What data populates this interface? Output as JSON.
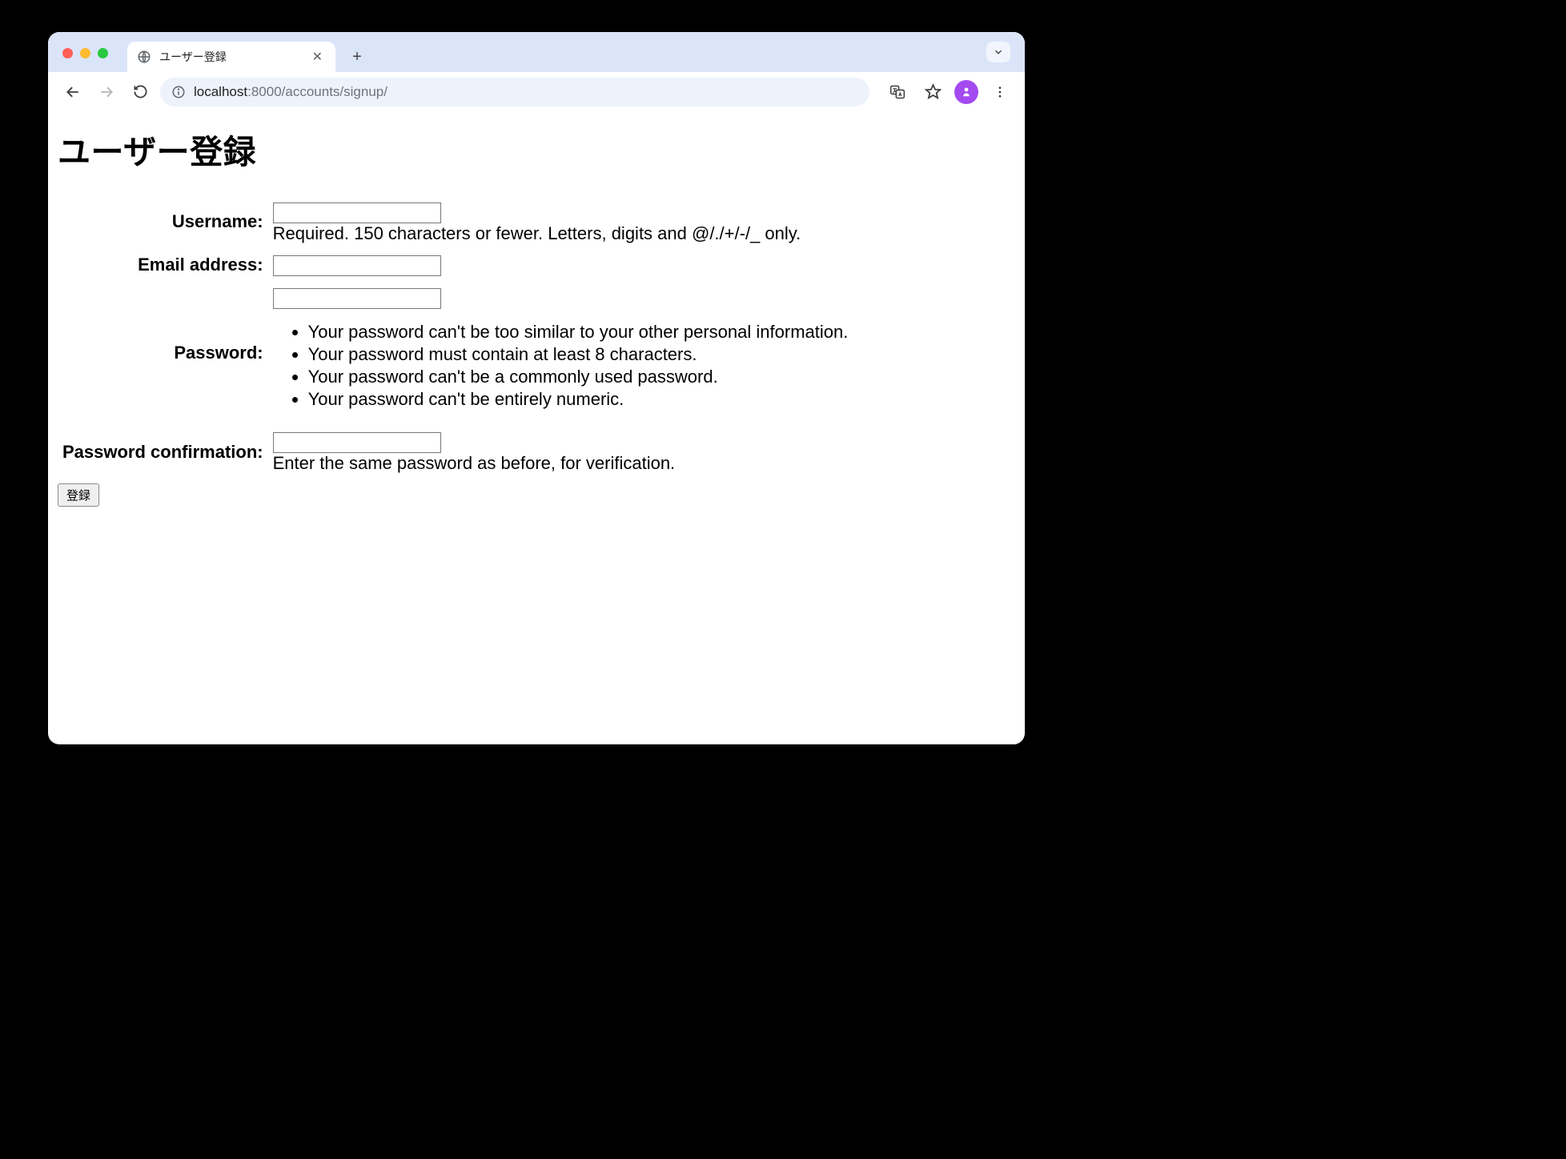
{
  "browser": {
    "tab_title": "ユーザー登録",
    "url_host": "localhost",
    "url_port": ":8000",
    "url_path": "/accounts/signup/"
  },
  "page": {
    "heading": "ユーザー登録",
    "form": {
      "username": {
        "label": "Username:",
        "help": "Required. 150 characters or fewer. Letters, digits and @/./+/-/_ only."
      },
      "email": {
        "label": "Email address:"
      },
      "password": {
        "label": "Password:",
        "rules": [
          "Your password can't be too similar to your other personal information.",
          "Your password must contain at least 8 characters.",
          "Your password can't be a commonly used password.",
          "Your password can't be entirely numeric."
        ]
      },
      "password_confirm": {
        "label": "Password confirmation:",
        "help": "Enter the same password as before, for verification."
      },
      "submit_label": "登録"
    }
  }
}
